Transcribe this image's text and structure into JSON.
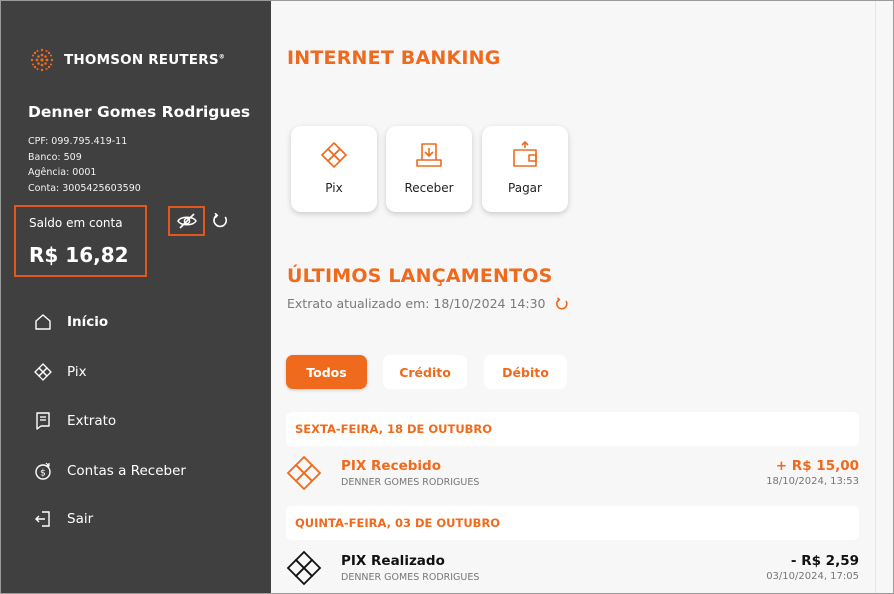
{
  "brand": {
    "name": "THOMSON REUTERS",
    "trademark": "®"
  },
  "user": {
    "name": "Denner Gomes Rodrigues",
    "cpf": "CPF: 099.795.419-11",
    "banco": "Banco: 509",
    "agencia": "Agência: 0001",
    "conta": "Conta: 3005425603590"
  },
  "balance": {
    "label": "Saldo em conta",
    "value": "R$ 16,82"
  },
  "nav": [
    {
      "label": "Início",
      "icon": "home-icon",
      "active": true
    },
    {
      "label": "Pix",
      "icon": "pix-icon",
      "active": false
    },
    {
      "label": "Extrato",
      "icon": "receipt-icon",
      "active": false
    },
    {
      "label": "Contas a Receber",
      "icon": "money-receive-icon",
      "active": false
    },
    {
      "label": "Sair",
      "icon": "logout-icon",
      "active": false
    }
  ],
  "main": {
    "title": "INTERNET BANKING",
    "quick_actions": [
      {
        "label": "Pix",
        "icon": "pix-icon"
      },
      {
        "label": "Receber",
        "icon": "receive-icon"
      },
      {
        "label": "Pagar",
        "icon": "wallet-icon"
      }
    ],
    "section_title": "ÚLTIMOS LANÇAMENTOS",
    "updated_text": "Extrato atualizado em: 18/10/2024 14:30",
    "filters": [
      {
        "label": "Todos",
        "active": true
      },
      {
        "label": "Crédito",
        "active": false
      },
      {
        "label": "Débito",
        "active": false
      }
    ],
    "groups": [
      {
        "day": "SEXTA-FEIRA, 18 DE OUTUBRO",
        "transactions": [
          {
            "title": "PIX Recebido",
            "subtitle": "DENNER GOMES RODRIGUES",
            "amount": "+ R$ 15,00",
            "datetime": "18/10/2024, 13:53",
            "type": "credit"
          }
        ]
      },
      {
        "day": "QUINTA-FEIRA, 03 DE OUTUBRO",
        "transactions": [
          {
            "title": "PIX Realizado",
            "subtitle": "DENNER GOMES RODRIGUES",
            "amount": "- R$ 2,59",
            "datetime": "03/10/2024, 17:05",
            "type": "debit"
          }
        ]
      }
    ]
  },
  "colors": {
    "accent": "#f06a1d",
    "sidebar": "#404040",
    "background": "#f7f7f7",
    "highlight_border": "#e2571c"
  }
}
